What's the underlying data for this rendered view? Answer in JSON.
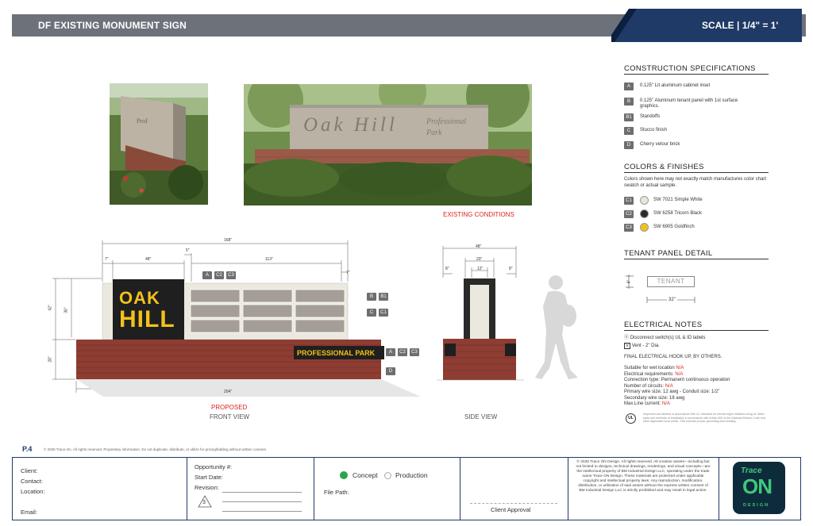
{
  "header": {
    "title": "DF EXISTING MONUMENT SIGN",
    "scale": "SCALE | 1/4\" = 1'"
  },
  "photos": {
    "caption": "EXISTING CONDITIONS",
    "existing_sign_text": "Oak Hill",
    "existing_sign_subtext_1": "Professional",
    "existing_sign_subtext_2": "Park"
  },
  "front_view": {
    "label": "FRONT VIEW",
    "proposed_label": "PROPOSED",
    "logo_line1": "OAK",
    "logo_line2": "HILL",
    "base_text": "PROFESSIONAL PARK",
    "dims": {
      "overall": "168\"",
      "left_margin": "7\"",
      "logo_width": "48\"",
      "gap": "5\"",
      "panel_width": "113\"",
      "right_margin": "7\"",
      "total_height": "42\"",
      "cabinet_height": "36\"",
      "base_height": "28\"",
      "base_width": "204\""
    },
    "callouts": {
      "top": [
        "A",
        "C2",
        "C3"
      ],
      "side1": [
        "B",
        "B1"
      ],
      "side2": [
        "C",
        "C1"
      ],
      "base": [
        "A",
        "C2",
        "C3"
      ],
      "bottom": [
        "D"
      ]
    }
  },
  "side_view": {
    "label": "SIDE VIEW",
    "dims": {
      "overall": "48\"",
      "inner": "20\"",
      "center": "12\"",
      "left": "8\"",
      "right": "8\""
    }
  },
  "construction_specs": {
    "title": "CONSTRUCTION SPECIFICATIONS",
    "items": [
      {
        "tag": "A",
        "text": "0.125\" Lit aluminum cabinet inset"
      },
      {
        "tag": "B",
        "text": "0.125\" Aluminum tenant panel with 1st surface graphics."
      },
      {
        "tag": "B1",
        "text": "Standoffs"
      },
      {
        "tag": "C",
        "text": "Stucco finish"
      },
      {
        "tag": "D",
        "text": "Cherry velour brick"
      }
    ]
  },
  "colors": {
    "title": "COLORS & FINISHES",
    "note": "Colors shown here may not exactly match manufactures color chart swatch or actual sample.",
    "items": [
      {
        "tag": "C1",
        "name": "SW 7021 Simple White",
        "color": "#e7e5dc"
      },
      {
        "tag": "C2",
        "name": "SW 6258 Tricorn Black",
        "color": "#2a2a2a"
      },
      {
        "tag": "C3",
        "name": "SW 6905 Goldfinch",
        "color": "#f2c21a"
      }
    ]
  },
  "tenant_panel": {
    "title": "TENANT PANEL DETAIL",
    "label": "TENANT",
    "width": "32\"",
    "height": "6\""
  },
  "electrical": {
    "title": "ELECTRICAL NOTES",
    "disconnect": "Disconnect switch(s) UL & ID labels",
    "vent": "Vent - 2\" Dia.",
    "hookup": "FINAL ELECTRICAL HOOK UP, BY OTHERS.",
    "wet_location_label": "Suitable for wet location",
    "wet_location_value": "N/A",
    "elec_req_label": "Electrical requirements:",
    "elec_req_value": "N/A",
    "connection": "Connection type: Permanent continuous operation",
    "circuits_label": "Number of circuits:",
    "circuits_value": "N/A",
    "primary": "Primary wire size: 12 awg - Conduit size: 1/2\"",
    "secondary": "Secondary wire size: 18 awg",
    "max_label": "Max.Line current:",
    "max_value": "N/A",
    "ul_fine": "Inspected and labeled in accordance with UL Standard for electric signs installed using UL listed parts and methods of installation in accordance with Article 600 of the National Electric Code and other applicable local codes. This includes proper grounding and bonding."
  },
  "footer": {
    "page": "P.4",
    "copyright_line": "© 2026 Trace-On. All rights reserved. Proprietary information. Do not duplicate, distribute, or utilize for pricing/bidding without written consent.",
    "client_label": "Client:",
    "contact_label": "Contact:",
    "location_label": "Location:",
    "email_label": "Email:",
    "opportunity_label": "Opportunity #:",
    "start_date_label": "Start Date:",
    "revision_label": "Revision:",
    "revision_num": "3",
    "concept_label": "Concept",
    "production_label": "Production",
    "file_path_label": "File Path:",
    "client_approval": "Client Approval",
    "legal": "© 2026 Trace ON Design. All rights reserved. All creative assets—including but not limited to designs, technical drawings, renderings, and visual concepts—are the intellectual property of BM Industrial Design LLC, operating under the trade name Trace ON Design. These materials are protected under applicable copyright and intellectual property laws. Any reproduction, modification, distribution, or utilization of said assets without the express written consent of BM Industrial Design LLC is strictly prohibited and may result in legal action.",
    "logo_word_1": "Trace",
    "logo_word_2": "ON",
    "logo_word_3": "DESIGN"
  }
}
